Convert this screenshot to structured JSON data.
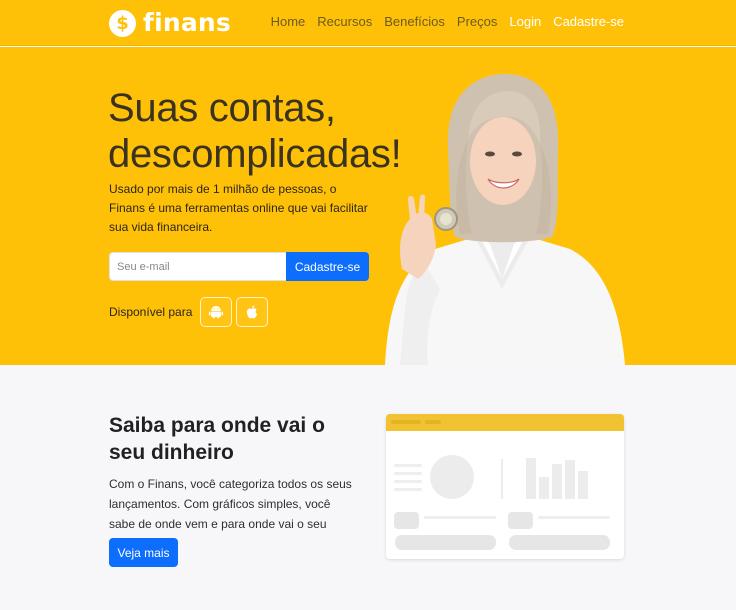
{
  "brand": {
    "symbol": "$",
    "name": "finans"
  },
  "nav": {
    "items": [
      {
        "label": "Home"
      },
      {
        "label": "Recursos"
      },
      {
        "label": "Benefícios"
      },
      {
        "label": "Preços"
      },
      {
        "label": "Login"
      },
      {
        "label": "Cadastre-se"
      }
    ]
  },
  "hero": {
    "title": "Suas contas, descomplicadas!",
    "description": "Usado por mais de 1 milhão de pessoas, o Finans é uma ferramentas online que vai facilitar sua vida financeira.",
    "email_placeholder": "Seu e-mail",
    "signup_label": "Cadastre-se",
    "available_label": "Disponível para"
  },
  "section2": {
    "title": "Saiba para onde vai o seu dinheiro",
    "description": "Com o Finans, você categoriza todos os seus lançamentos. Com gráficos simples, você sabe de onde vem e para onde vai o seu dinheiro",
    "cta_label": "Veja mais"
  },
  "colors": {
    "primary_yellow": "#ffc107",
    "button_blue": "#0d6efd",
    "light_bg": "#f7f6f8"
  },
  "icons": {
    "logo": "dollar-coin-icon",
    "android": "android-icon",
    "apple": "apple-icon"
  }
}
